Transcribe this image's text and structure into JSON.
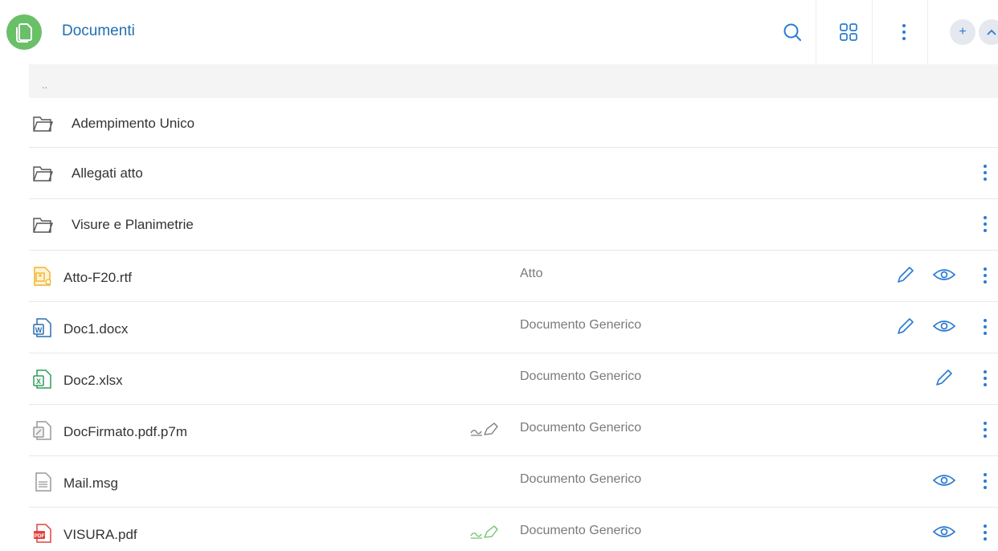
{
  "header": {
    "title": "Documenti",
    "icons": [
      "document-app-icon",
      "search-icon",
      "grid-view-icon",
      "more-vert-icon",
      "plus-icon",
      "chevron-up-icon"
    ]
  },
  "list": {
    "parent_label": "..",
    "folders": [
      {
        "name": "Adempimento Unico"
      },
      {
        "name": "Allegati atto"
      },
      {
        "name": "Visure e Planimetrie"
      }
    ],
    "files": [
      {
        "name": "Atto-F20.rtf",
        "type": "Atto",
        "icon": "rtf-file-icon"
      },
      {
        "name": "Doc1.docx",
        "type": "Documento Generico",
        "icon": "word-file-icon"
      },
      {
        "name": "Doc2.xlsx",
        "type": "Documento Generico",
        "icon": "excel-file-icon"
      },
      {
        "name": "DocFirmato.pdf.p7m",
        "type": "Documento Generico",
        "icon": "signed-file-icon"
      },
      {
        "name": "Mail.msg",
        "type": "Documento Generico",
        "icon": "mail-file-icon"
      },
      {
        "name": "VISURA.pdf",
        "type": "Documento Generico",
        "icon": "pdf-file-icon"
      }
    ]
  },
  "colors": {
    "accent": "#2a7bd2",
    "app_icon": "#6abf69",
    "title": "#1f6fb2",
    "pdf": "#e0443e",
    "word": "#2b6cb0",
    "excel": "#2e9e5b",
    "rtf": "#f0b429",
    "signature_valid": "#6abf69"
  }
}
